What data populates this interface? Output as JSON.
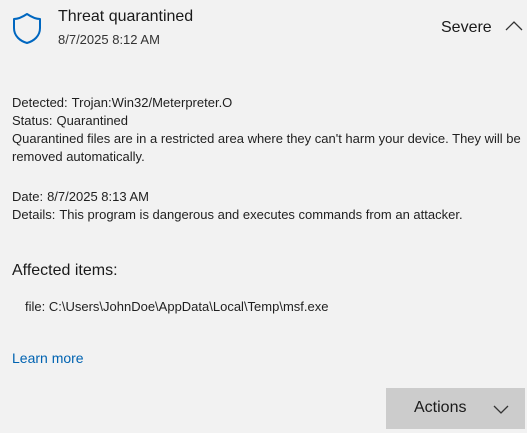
{
  "header": {
    "title": "Threat quarantined",
    "timestamp": "8/7/2025 8:12 AM",
    "severity": "Severe"
  },
  "details": {
    "detected_label": "Detected:",
    "detected_value": "Trojan:Win32/Meterpreter.O",
    "status_label": "Status:",
    "status_value": "Quarantined",
    "description": "Quarantined files are in a restricted area where they can't harm your device. They will be removed automatically."
  },
  "meta": {
    "date_label": "Date:",
    "date_value": "8/7/2025 8:13 AM",
    "details_label": "Details:",
    "details_value": "This program is dangerous and executes commands from an attacker."
  },
  "affected": {
    "heading": "Affected items:",
    "item": "file: C:\\Users\\JohnDoe\\AppData\\Local\\Temp\\msf.exe"
  },
  "links": {
    "learn_more": "Learn more"
  },
  "actions": {
    "label": "Actions"
  },
  "colors": {
    "accent": "#0063b1",
    "background": "#f2f2f2",
    "button": "#cccccc"
  },
  "icons": {
    "shield": "shield-icon",
    "collapse": "chevron-up-icon",
    "dropdown": "chevron-down-icon"
  }
}
